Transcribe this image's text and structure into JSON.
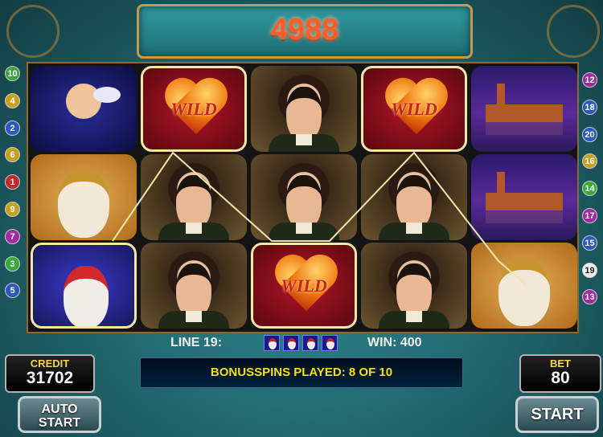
{
  "win_display": "4988",
  "info": {
    "line_label": "LINE 19:",
    "win_label": "WIN: 400"
  },
  "credit": {
    "label": "CREDIT",
    "value": "31702"
  },
  "bet": {
    "label": "BET",
    "value": "80"
  },
  "status": "BONUSSPINS PLAYED: 8 OF 10",
  "buttons": {
    "auto_start_line1": "AUTO",
    "auto_start_line2": "START",
    "start": "START"
  },
  "reels": [
    [
      "cupid",
      "mask",
      "harlequin"
    ],
    [
      "wild",
      "gentleman",
      "gentleman"
    ],
    [
      "gentleman",
      "gentleman",
      "wild"
    ],
    [
      "wild",
      "gentleman",
      "gentleman"
    ],
    [
      "venice",
      "venice",
      "mask"
    ]
  ],
  "symbols": {
    "wild_text": "WILD"
  },
  "highlighted_line": 19,
  "line_numbers_left": [
    {
      "n": "10",
      "color": "#3aa83a"
    },
    {
      "n": "4",
      "color": "#c8a020"
    },
    {
      "n": "2",
      "color": "#2a5ac0"
    },
    {
      "n": "6",
      "color": "#c8a020"
    },
    {
      "n": "1",
      "color": "#c02a2a"
    },
    {
      "n": "9",
      "color": "#c8a020"
    },
    {
      "n": "7",
      "color": "#a02aa0"
    },
    {
      "n": "3",
      "color": "#3aa83a"
    },
    {
      "n": "5",
      "color": "#2a5ac0"
    }
  ],
  "line_numbers_right": [
    {
      "n": "12",
      "color": "#a02aa0"
    },
    {
      "n": "18",
      "color": "#2a5ac0"
    },
    {
      "n": "20",
      "color": "#2a5ac0"
    },
    {
      "n": "16",
      "color": "#c8a020"
    },
    {
      "n": "14",
      "color": "#3aa83a"
    },
    {
      "n": "17",
      "color": "#a02aa0"
    },
    {
      "n": "15",
      "color": "#2a5ac0"
    },
    {
      "n": "19",
      "color": "#f0f0f0"
    },
    {
      "n": "13",
      "color": "#a02aa0"
    }
  ]
}
